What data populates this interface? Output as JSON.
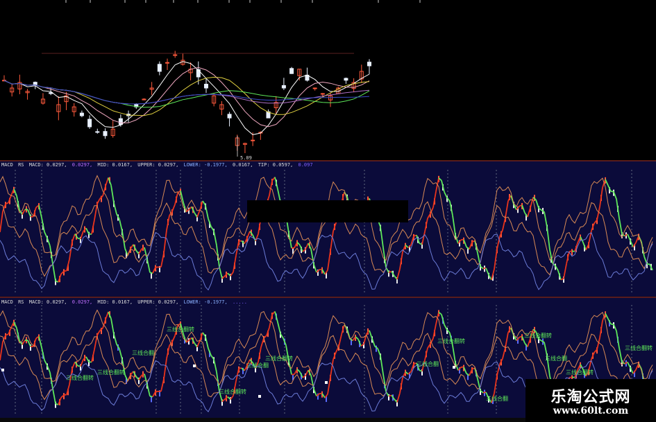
{
  "colors": {
    "background": "#000000",
    "indicator_bg": "#0b0b3a",
    "separator": "#8a2a1a",
    "up": "#ff5a3c",
    "down": "#e8f0ff",
    "green": "#5ee85a",
    "red": "#e8341c",
    "orange": "#d98a55",
    "blue": "#6c7cd8",
    "purple": "#b070c8",
    "pink": "#f0a8c0",
    "blue_bar": "#5a6cff"
  },
  "panels": {
    "price": {
      "low_label": "5.09"
    },
    "indicator1": {
      "header": [
        "MACD",
        "RS",
        "MACD: 0.0297,",
        "0.0297,",
        "MID: 0.0167,",
        "UPPER: 0.0297,",
        "LOWER: -0.1977,",
        "0.0167,",
        "TIP: 0.0597,",
        "0.097"
      ]
    },
    "indicator2": {
      "header": [
        "MACD",
        "RS",
        "MACD: 0.0297,",
        "0.0297,",
        "MID: 0.0167,",
        "UPPER: 0.0297,",
        "LOWER: -0.1977,",
        "....."
      ]
    },
    "signal_label": "三线合翻转",
    "signal_label_short": "三线合翻"
  },
  "watermark": {
    "title": "乐淘公式网",
    "url": "www.60lt.com"
  },
  "chart_data": [
    {
      "type": "candlestick",
      "panel": "price",
      "values_description": "",
      "low_marker": 5.09,
      "close_profile": [
        0.62,
        0.55,
        0.6,
        0.52,
        0.58,
        0.45,
        0.5,
        0.4,
        0.48,
        0.38,
        0.3,
        0.2,
        0.15,
        0.12,
        0.18,
        0.22,
        0.3,
        0.38,
        0.45,
        0.55,
        0.7,
        0.78,
        0.85,
        0.8,
        0.72,
        0.65,
        0.55,
        0.48,
        0.4,
        0.28,
        0.1,
        0.05,
        0.08,
        0.15,
        0.28,
        0.42,
        0.55,
        0.68,
        0.72,
        0.62,
        0.55,
        0.5,
        0.48,
        0.55,
        0.62,
        0.6,
        0.7,
        0.75
      ]
    },
    {
      "type": "line",
      "panel": "indicator1",
      "series": [
        {
          "name": "MACD",
          "color": "red"
        },
        {
          "name": "MID",
          "color": "orange"
        },
        {
          "name": "UPPER",
          "color": "orange"
        },
        {
          "name": "LOWER",
          "color": "blue"
        }
      ]
    },
    {
      "type": "line",
      "panel": "indicator2",
      "series": [
        {
          "name": "MACD",
          "color": "red"
        },
        {
          "name": "MID",
          "color": "orange"
        },
        {
          "name": "UPPER",
          "color": "orange"
        },
        {
          "name": "LOWER",
          "color": "blue"
        }
      ]
    }
  ]
}
